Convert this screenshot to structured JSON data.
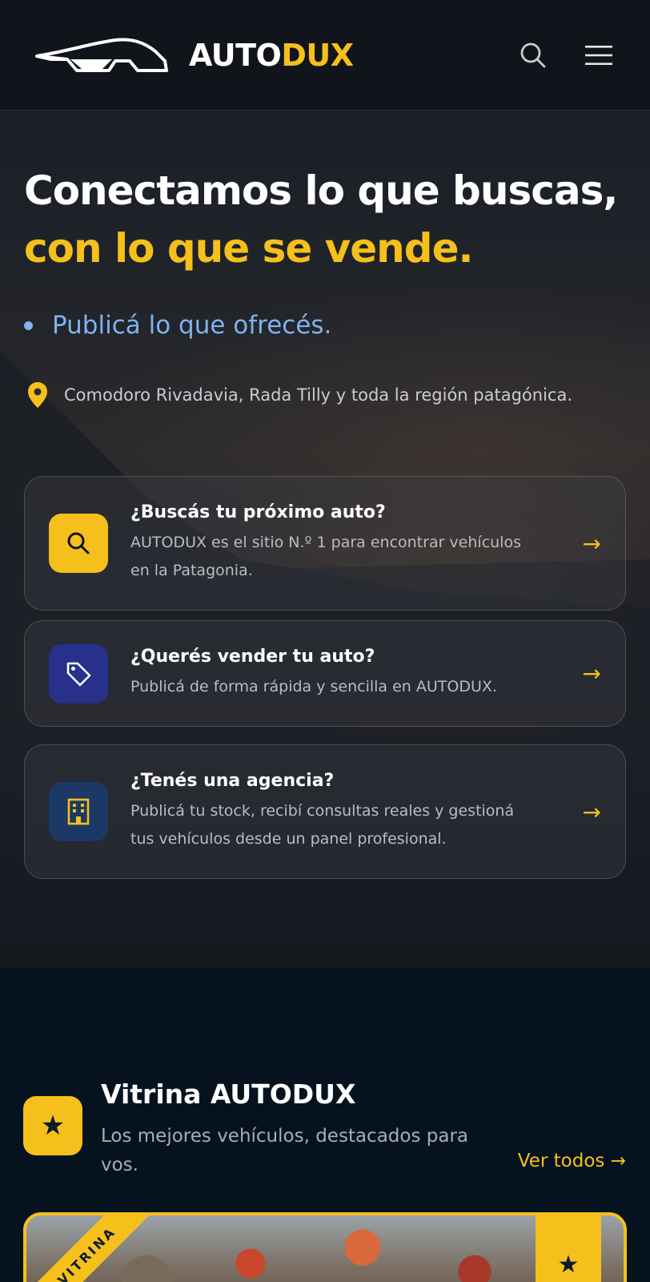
{
  "header": {
    "brand_part1": "AUTO",
    "brand_part2": "DUX",
    "icons": [
      "car-logo-icon",
      "search-icon",
      "menu-icon"
    ]
  },
  "hero": {
    "title_line1": "Conectamos lo que buscas,",
    "title_line2": "con lo que se vende.",
    "bullet": "Publicá lo que ofrecés.",
    "location": "Comodoro Rivadavia, Rada Tilly y toda la región patagónica."
  },
  "cards": [
    {
      "title": "¿Buscás tu próximo auto?",
      "desc_line1": "AUTODUX es el sitio N.º 1 para encontrar vehículos",
      "desc_line2": "en la Patagonia.",
      "icon": "search-icon",
      "arrow": "→"
    },
    {
      "title": "¿Querés vender tu auto?",
      "desc_line1": "Publicá de forma rápida y sencilla en AUTODUX.",
      "icon": "tag-icon",
      "arrow": "→"
    },
    {
      "title": "¿Tenés una agencia?",
      "desc_line1": "Publicá tu stock, recibí consultas reales y gestioná",
      "desc_line2": "tus vehículos desde un panel profesional.",
      "icon": "building-icon",
      "arrow": "→"
    }
  ],
  "vitrina": {
    "title": "Vitrina AUTODUX",
    "subtitle": "Los mejores vehículos, destacados para vos.",
    "see_all": "Ver todos →",
    "ribbon": "VITRINA",
    "star": "★"
  },
  "colors": {
    "accent": "#f5c01c",
    "bullet_blue": "#7fb2f0",
    "tag_bg": "#27308a",
    "building_bg": "#1c3866",
    "section_bg": "#06131f"
  }
}
